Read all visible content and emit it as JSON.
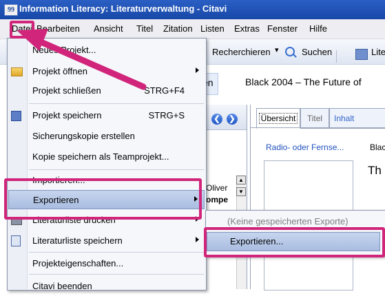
{
  "window": {
    "title": "Information Literacy: Literaturverwaltung - Citavi",
    "app_icon_glyph": "99"
  },
  "menubar": {
    "items": [
      "Datei",
      "Bearbeiten",
      "Ansicht",
      "Titel",
      "Zitation",
      "Listen",
      "Extras",
      "Fenster",
      "Hilfe"
    ]
  },
  "toolbar": {
    "recherchieren": "Recherchieren",
    "suchen": "Suchen",
    "lite": "Lite"
  },
  "reference_bar": {
    "tab_label": "en",
    "title": "Black 2004 – The Future of"
  },
  "list_pane": {
    "author": "Oliver",
    "author_line2": "ompe"
  },
  "detail_tabs": {
    "uebersicht": "Übersicht",
    "titel": "Titel",
    "inhalt": "Inhalt"
  },
  "detail": {
    "link": "Radio- oder Fernse...",
    "blac": "Blac",
    "th": "Th"
  },
  "datei_menu": {
    "items": [
      {
        "label": "Neues Projekt...",
        "shortcut": "",
        "submenu": false,
        "icon": ""
      },
      {
        "label": "Projekt öffnen",
        "shortcut": "",
        "submenu": true,
        "icon": "folder-open-icon"
      },
      {
        "label": "Projekt schließen",
        "shortcut": "STRG+F4",
        "submenu": false,
        "icon": ""
      },
      {
        "label": "Projekt speichern",
        "shortcut": "STRG+S",
        "submenu": false,
        "icon": "save-icon"
      },
      {
        "label": "Sicherungskopie erstellen",
        "shortcut": "",
        "submenu": false,
        "icon": ""
      },
      {
        "label": "Kopie speichern als Teamprojekt...",
        "shortcut": "",
        "submenu": false,
        "icon": ""
      },
      {
        "label": "Importieren...",
        "shortcut": "",
        "submenu": false,
        "icon": ""
      },
      {
        "label": "Exportieren",
        "shortcut": "",
        "submenu": true,
        "icon": ""
      },
      {
        "label": "Literaturliste drucken",
        "shortcut": "",
        "submenu": true,
        "icon": "print-icon"
      },
      {
        "label": "Literaturliste speichern",
        "shortcut": "",
        "submenu": true,
        "icon": "document-save-icon"
      },
      {
        "label": "Projekteigenschaften...",
        "shortcut": "",
        "submenu": false,
        "icon": ""
      },
      {
        "label": "Citavi beenden",
        "shortcut": "",
        "submenu": false,
        "icon": ""
      }
    ]
  },
  "export_submenu": {
    "none_saved": "(Keine gespeicherten Exporte)",
    "exportieren": "Exportieren..."
  },
  "colors": {
    "highlight": "#d0257a",
    "titlebar": "#1f52b5",
    "selection": "#b8c9e8"
  }
}
